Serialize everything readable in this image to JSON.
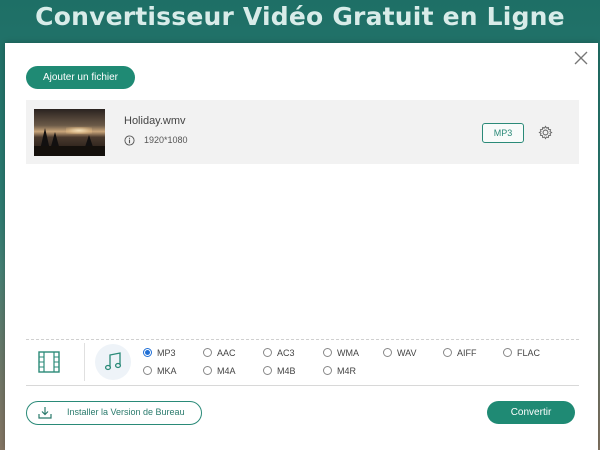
{
  "banner": {
    "title": "Convertisseur Vidéo Gratuit en Ligne"
  },
  "toolbar": {
    "add_file_label": "Ajouter un fichier"
  },
  "file": {
    "name": "Holiday.wmv",
    "resolution": "1920*1080",
    "output_format": "MP3"
  },
  "format_tabs": {
    "active": "audio"
  },
  "audio_formats": {
    "selected": "MP3",
    "options": [
      "MP3",
      "AAC",
      "AC3",
      "WMA",
      "WAV",
      "AIFF",
      "FLAC",
      "MKA",
      "M4A",
      "M4B",
      "M4R"
    ]
  },
  "footer": {
    "install_label": "Installer la Version de Bureau",
    "convert_label": "Convertir"
  },
  "colors": {
    "accent": "#1f8a74",
    "radio_selected": "#1f6fd6"
  },
  "icons": [
    "close-icon",
    "info-icon",
    "gear-icon",
    "film-icon",
    "music-note-icon",
    "download-icon"
  ]
}
